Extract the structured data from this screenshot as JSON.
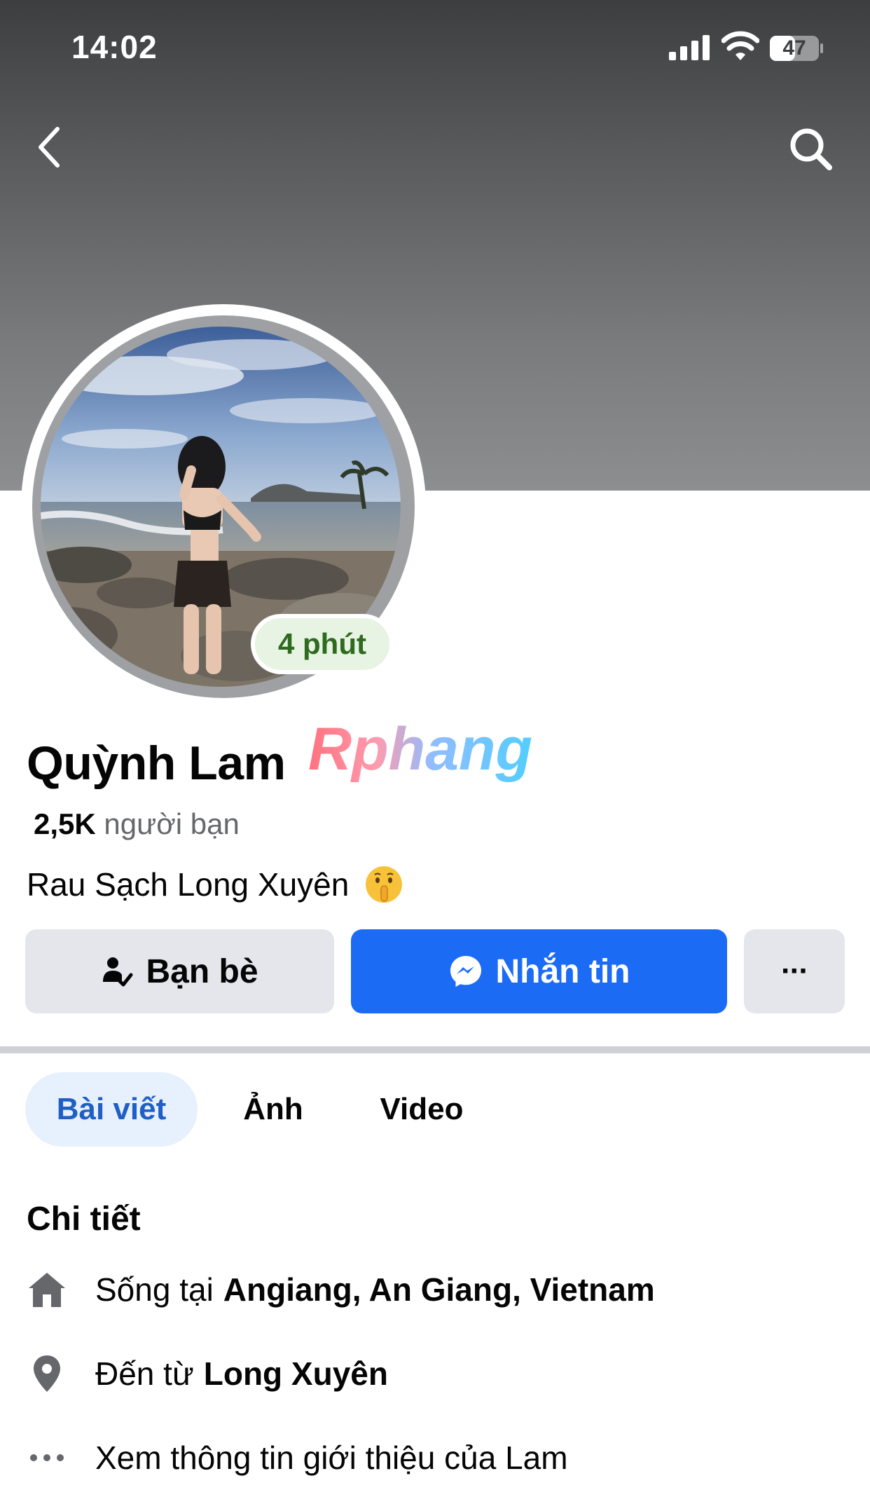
{
  "status_bar": {
    "time": "14:02",
    "battery": "47"
  },
  "watermark": "Rphang",
  "profile": {
    "name": "Quỳnh Lam",
    "story_badge": "4 phút",
    "friends_count": "2,5K",
    "friends_label": "người bạn",
    "bio": "Rau Sạch Long Xuyên"
  },
  "actions": {
    "friends_label": "Bạn bè",
    "message_label": "Nhắn tin",
    "more_label": "···"
  },
  "tabs": [
    {
      "label": "Bài viết",
      "active": true
    },
    {
      "label": "Ảnh",
      "active": false
    },
    {
      "label": "Video",
      "active": false
    }
  ],
  "details": {
    "title": "Chi tiết",
    "lives_prefix": "Sống tại",
    "lives_value": "Angiang, An Giang, Vietnam",
    "from_prefix": "Đến từ",
    "from_value": "Long Xuyên",
    "see_about": "Xem thông tin giới thiệu của Lam"
  },
  "colors": {
    "accent": "#1b6bf5",
    "active_tab_bg": "#e7f0fd",
    "active_tab_text": "#1f5fc6",
    "story_badge_text": "#2f6b1f"
  },
  "icons": [
    "chevron-left-icon",
    "search-icon",
    "signal-icon",
    "wifi-icon",
    "battery-icon",
    "shushing-face-icon",
    "friend-check-icon",
    "messenger-icon",
    "home-icon",
    "location-pin-icon",
    "more-dots-icon"
  ]
}
